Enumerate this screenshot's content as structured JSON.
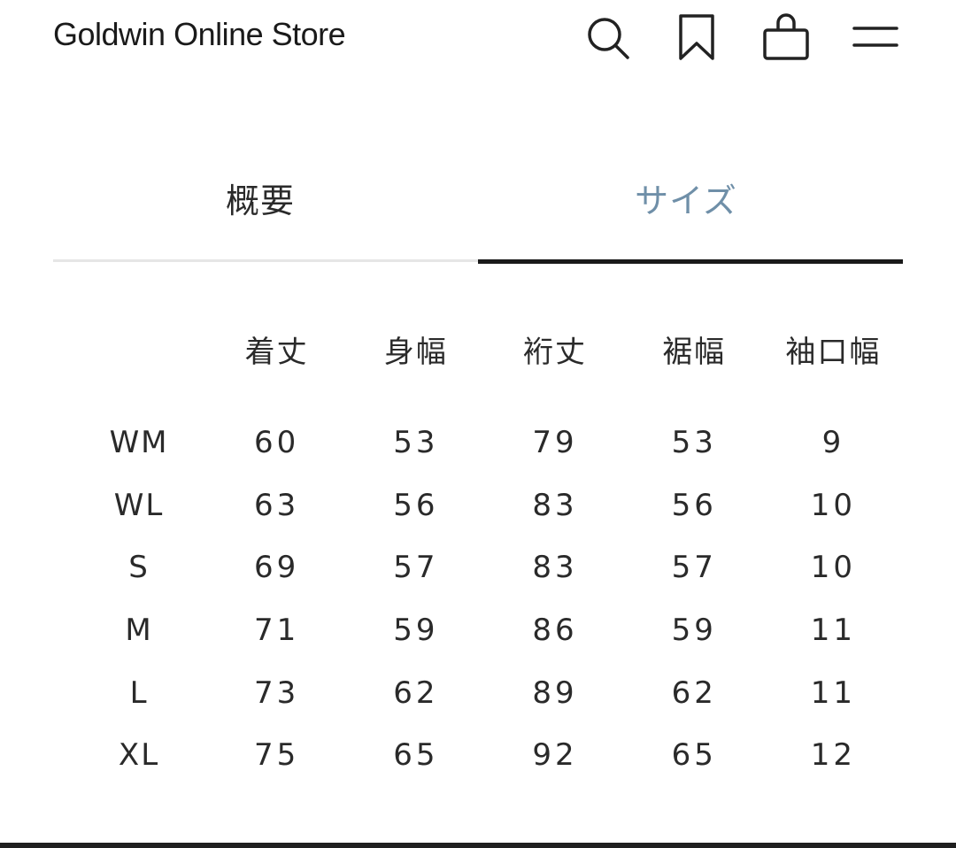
{
  "header": {
    "store_title": "Goldwin Online Store",
    "icons": [
      "search-icon",
      "bookmark-icon",
      "shopping-bag-icon",
      "menu-icon"
    ]
  },
  "tabs": [
    {
      "label": "概要",
      "active": false
    },
    {
      "label": "サイズ",
      "active": true
    }
  ],
  "colors": {
    "active_tab_text": "#6f8fa8",
    "active_underline": "#1a1a1a",
    "inactive_underline": "#e6e6e6",
    "text": "#2a2a2a"
  },
  "size_table": {
    "columns": [
      "着丈",
      "身幅",
      "裄丈",
      "裾幅",
      "袖口幅"
    ],
    "rows": [
      {
        "size": "WM",
        "values": [
          "60",
          "53",
          "79",
          "53",
          "9"
        ]
      },
      {
        "size": "WL",
        "values": [
          "63",
          "56",
          "83",
          "56",
          "10"
        ]
      },
      {
        "size": "S",
        "values": [
          "69",
          "57",
          "83",
          "57",
          "10"
        ]
      },
      {
        "size": "M",
        "values": [
          "71",
          "59",
          "86",
          "59",
          "11"
        ]
      },
      {
        "size": "L",
        "values": [
          "73",
          "62",
          "89",
          "62",
          "11"
        ]
      },
      {
        "size": "XL",
        "values": [
          "75",
          "65",
          "92",
          "65",
          "12"
        ]
      }
    ]
  }
}
